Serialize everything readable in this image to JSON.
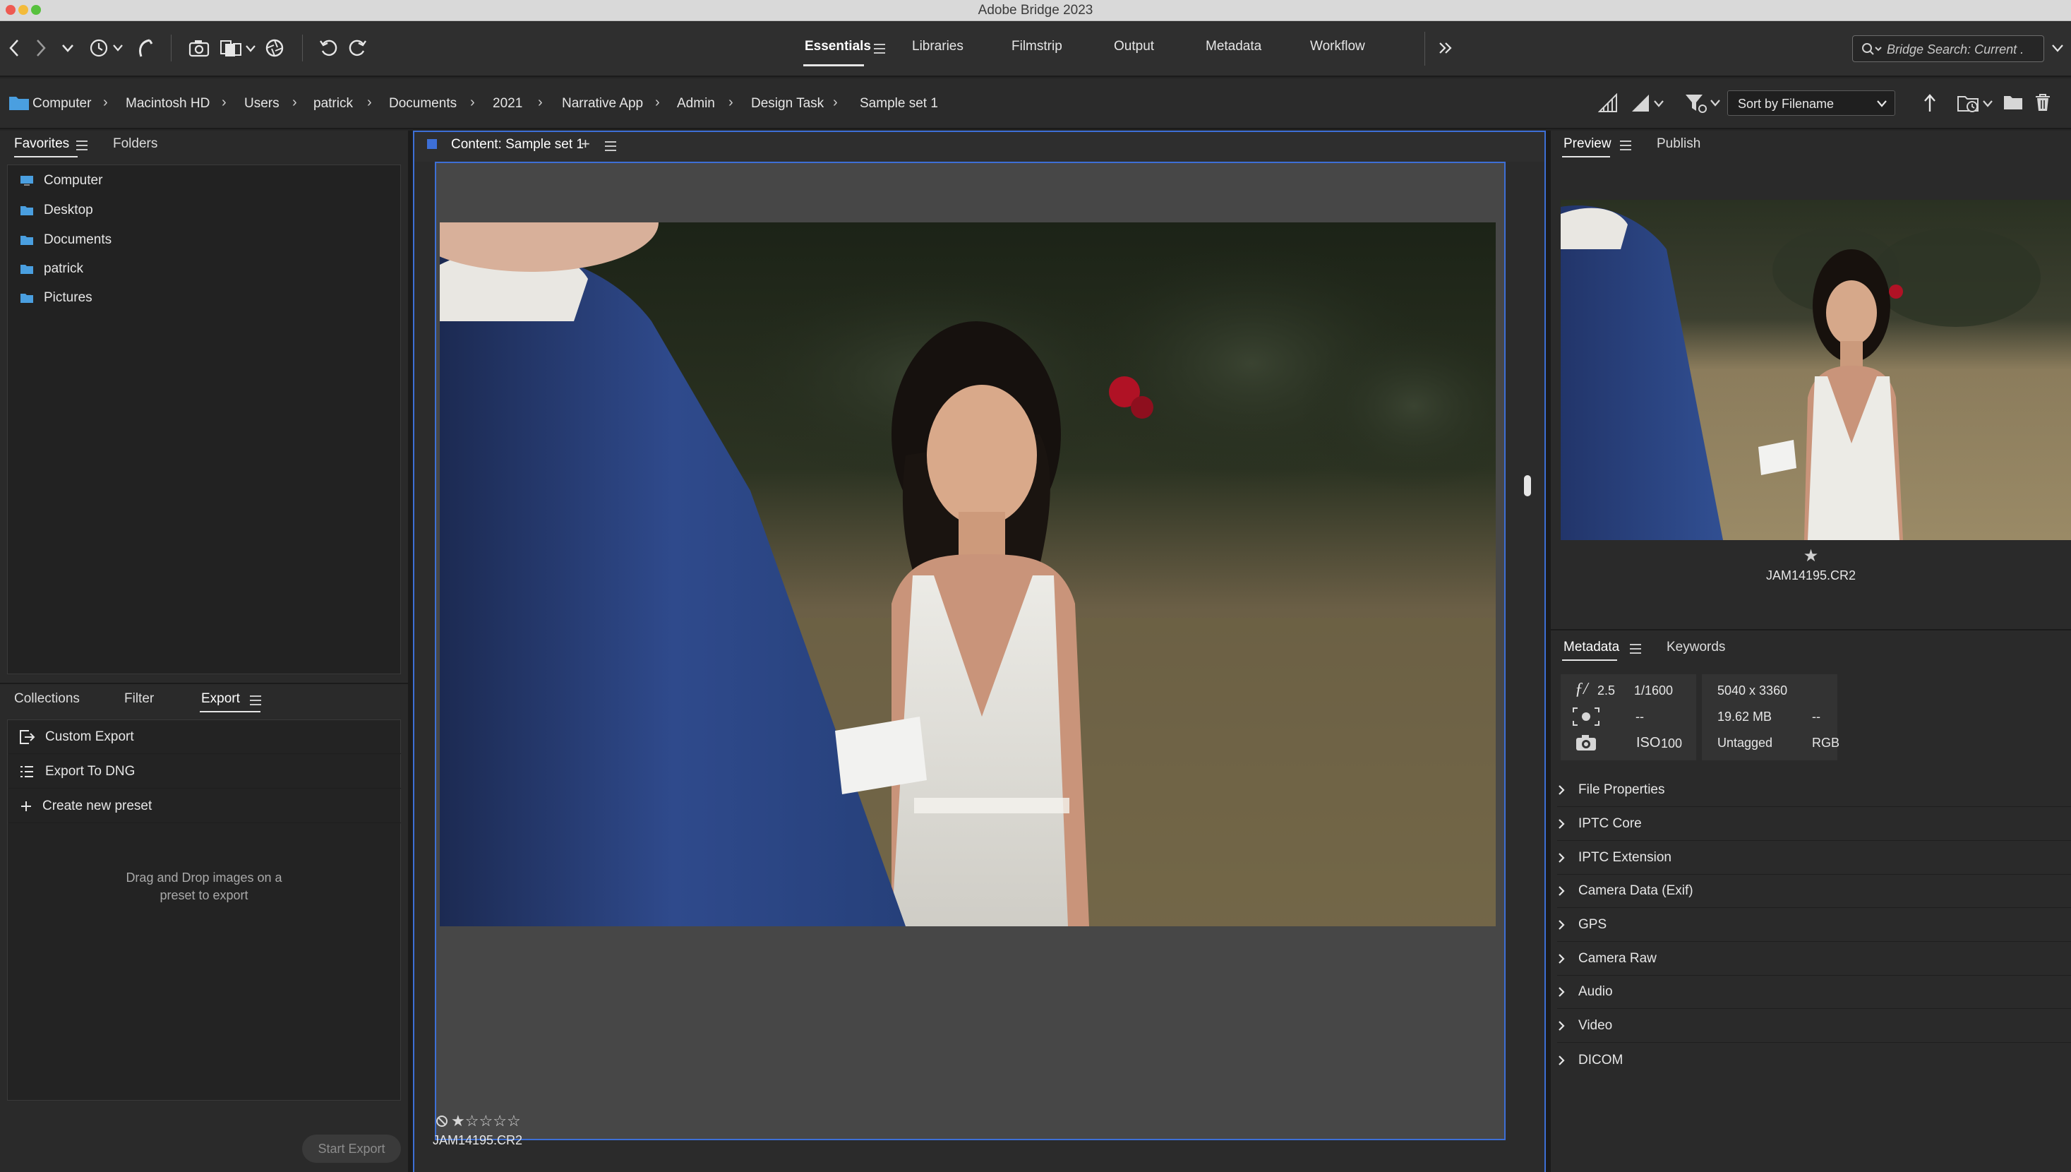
{
  "window": {
    "title": "Adobe Bridge 2023"
  },
  "toolbar": {
    "workspaces": [
      {
        "label": "Essentials",
        "active": true
      },
      {
        "label": "Libraries"
      },
      {
        "label": "Filmstrip"
      },
      {
        "label": "Output"
      },
      {
        "label": "Metadata"
      },
      {
        "label": "Workflow"
      }
    ],
    "search_placeholder": "Bridge Search: Current ."
  },
  "path": {
    "crumbs": [
      "Computer",
      "Macintosh HD",
      "Users",
      "patrick",
      "Documents",
      "2021",
      "Narrative App",
      "Admin",
      "Design Task",
      "Sample set 1"
    ],
    "sort_label": "Sort by Filename"
  },
  "left_top": {
    "tabs": [
      "Favorites",
      "Folders"
    ],
    "favorites": [
      "Computer",
      "Desktop",
      "Documents",
      "patrick",
      "Pictures"
    ]
  },
  "left_bottom": {
    "tabs": [
      "Collections",
      "Filter",
      "Export"
    ],
    "export_items": [
      "Custom Export",
      "Export To DNG",
      "Create new preset"
    ],
    "drop_hint_line1": "Drag and Drop images on a",
    "drop_hint_line2": "preset to export",
    "start_button": "Start Export"
  },
  "content": {
    "tab_label": "Content: Sample set 1",
    "add_symbol": "+",
    "filename": "JAM14195.CR2",
    "rating_stars": 1
  },
  "preview": {
    "tabs": [
      "Preview",
      "Publish"
    ],
    "filename": "JAM14195.CR2",
    "star": "★"
  },
  "metadata": {
    "tabs": [
      "Metadata",
      "Keywords"
    ],
    "aperture": "2.5",
    "shutter": "1/1600",
    "metering": "--",
    "iso_label": "ISO",
    "iso": "100",
    "dimensions": "5040 x 3360",
    "filesize": "19.62 MB",
    "resolution": "--",
    "color_profile": "Untagged",
    "color_mode": "RGB",
    "sections": [
      "File Properties",
      "IPTC Core",
      "IPTC Extension",
      "Camera Data (Exif)",
      "GPS",
      "Camera Raw",
      "Audio",
      "Video",
      "DICOM"
    ]
  },
  "colors": {
    "accent": "#3d6fd6",
    "panel": "#2a2a2a",
    "dark": "#242424",
    "folder": "#4a9fe0"
  }
}
